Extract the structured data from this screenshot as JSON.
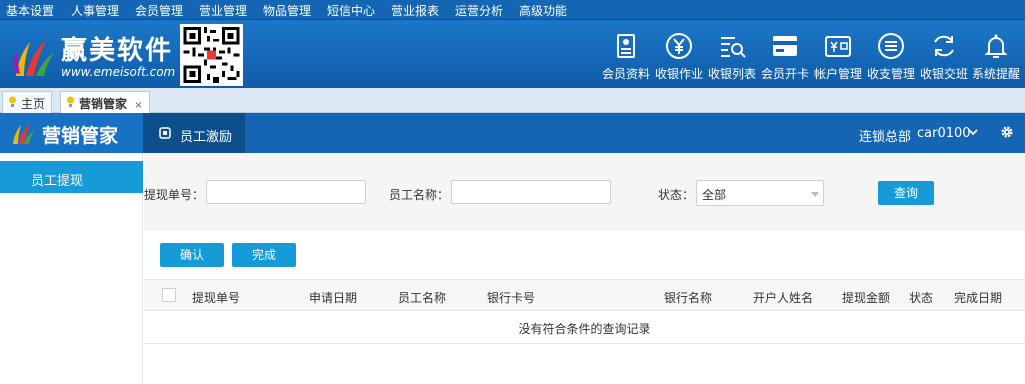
{
  "top_menu": [
    "基本设置",
    "人事管理",
    "会员管理",
    "营业管理",
    "物品管理",
    "短信中心",
    "营业报表",
    "运营分析",
    "高级功能"
  ],
  "brand": {
    "name": "赢美软件",
    "url": "www.emeisoft.com",
    "colors": {
      "header": "#1466b4",
      "accent": "#169bd8"
    }
  },
  "toolbar": [
    {
      "label": "会员资料",
      "icon": "member-card-icon"
    },
    {
      "label": "收银作业",
      "icon": "yen-icon"
    },
    {
      "label": "收银列表",
      "icon": "list-search-icon"
    },
    {
      "label": "会员开卡",
      "icon": "open-card-icon"
    },
    {
      "label": "帐户管理",
      "icon": "wallet-icon"
    },
    {
      "label": "收支管理",
      "icon": "ledger-icon"
    },
    {
      "label": "收银交班",
      "icon": "refresh-icon"
    },
    {
      "label": "系统提醒",
      "icon": "bell-icon"
    }
  ],
  "tabs": [
    {
      "label": "主页"
    },
    {
      "label": "营销管家",
      "close": "×"
    }
  ],
  "module": {
    "title": "营销管家",
    "tab": "员工激励",
    "branch": "连锁总部",
    "user": "car0100"
  },
  "sidebar": {
    "items": [
      "员工提现"
    ]
  },
  "filters": {
    "withdraw_no_label": "提现单号：",
    "withdraw_no_value": "",
    "employee_name_label": "员工名称：",
    "employee_name_value": "",
    "status_label": "状态：",
    "status_value": "全部",
    "query_button": "查询"
  },
  "actions": {
    "confirm": "确认",
    "complete": "完成"
  },
  "table": {
    "columns": [
      "提现单号",
      "申请日期",
      "员工名称",
      "银行卡号",
      "银行名称",
      "开户人姓名",
      "提现金额",
      "状态",
      "完成日期"
    ],
    "empty_message": "没有符合条件的查询记录"
  }
}
